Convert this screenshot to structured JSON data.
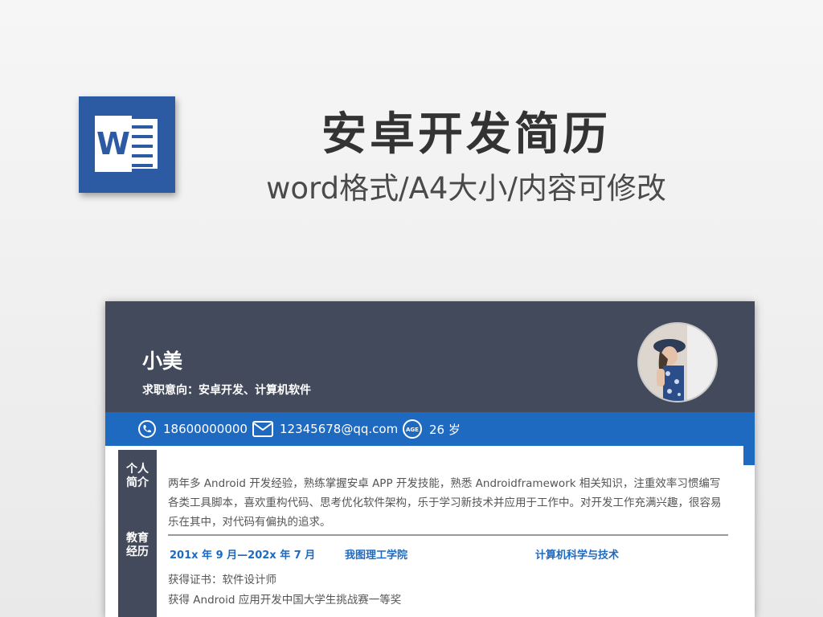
{
  "hero": {
    "title": "安卓开发简历",
    "subtitle": "word格式/A4大小/内容可修改",
    "word_icon_letter": "W"
  },
  "resume": {
    "name": "小美",
    "intent": "求职意向：安卓开发、计算机软件",
    "contact": {
      "phone": "18600000000",
      "email": "12345678@qq.com",
      "age": "26 岁",
      "age_badge": "AGE"
    },
    "sections": {
      "profile_label": "个人\n简介",
      "profile_text": "两年多 Android 开发经验，熟练掌握安卓 APP 开发技能，熟悉 Androidframework 相关知识，注重效率习惯编写各类工具脚本，喜欢重构代码、思考优化软件架构，乐于学习新技术并应用于工作中。对开发工作充满兴趣，很容易乐在其中，对代码有偏执的追求。",
      "education_label": "教育\n经历",
      "education": {
        "period": "201x 年 9 月—202x 年 7 月",
        "school": "我图理工学院",
        "major": "计算机科学与技术",
        "line1": "获得证书：软件设计师",
        "line2": "获得 Android  应用开发中国大学生挑战赛一等奖"
      }
    }
  },
  "colors": {
    "header": "#434a5b",
    "accent_blue": "#1f6ac1",
    "word_blue": "#2c5ba3"
  }
}
